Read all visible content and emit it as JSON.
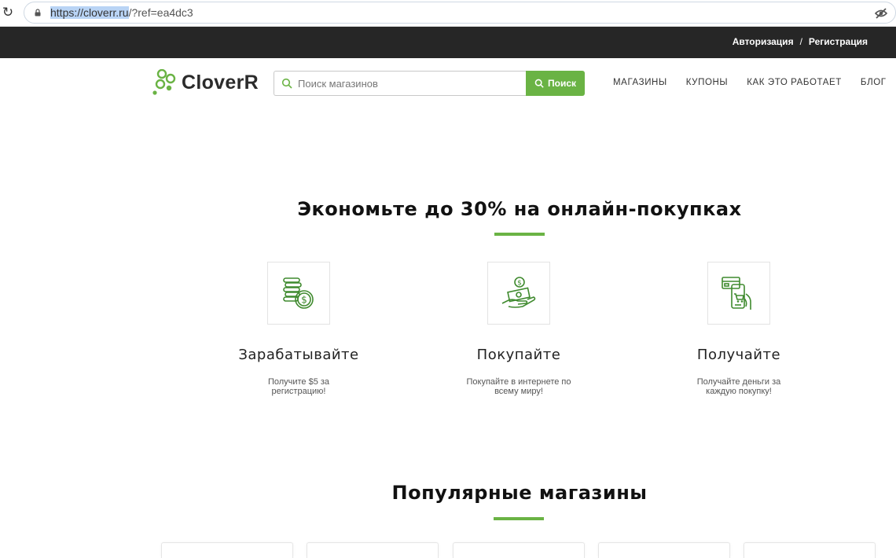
{
  "browser": {
    "url_selected": "https://cloverr.ru",
    "url_rest": "/?ref=ea4dc3"
  },
  "topbar": {
    "login": "Авторизация",
    "separator": "/",
    "register": "Регистрация"
  },
  "header": {
    "logo": "CloverR",
    "search_placeholder": "Поиск магазинов",
    "search_button": "Поиск",
    "nav": [
      "МАГАЗИНЫ",
      "КУПОНЫ",
      "КАК ЭТО РАБОТАЕТ",
      "БЛОГ"
    ]
  },
  "hero": {
    "title": "Экономьте до 30% на онлайн-покупках",
    "features": [
      {
        "icon": "coins-icon",
        "title": "Зарабатывайте",
        "desc": "Получите $5 за регистрацию!"
      },
      {
        "icon": "money-hand-icon",
        "title": "Покупайте",
        "desc": "Покупайте в интернете по всему миру!"
      },
      {
        "icon": "phone-card-icon",
        "title": "Получайте",
        "desc": "Получайте деньги за каждую покупку!"
      }
    ]
  },
  "popular": {
    "title": "Популярные магазины"
  },
  "colors": {
    "accent": "#6ab344",
    "topbar": "#262626"
  }
}
